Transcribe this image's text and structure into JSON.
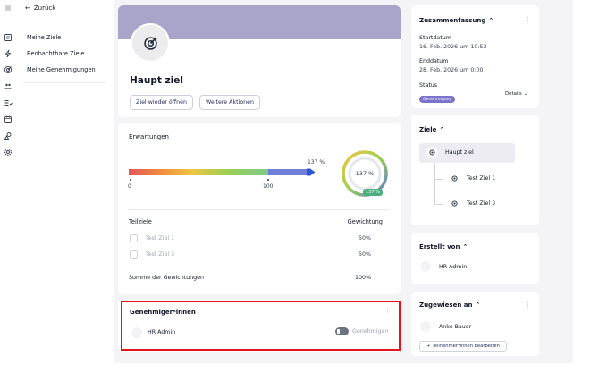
{
  "colors": {
    "accent": "#a9a4c9",
    "status_badge": "#7b72c9",
    "progress_badge": "#4cae7e",
    "highlight_outline": "#e0141e"
  },
  "rail": {
    "icons": [
      "menu-icon",
      "document-icon",
      "lightning-icon",
      "target-icon",
      "people-icon",
      "list-icon",
      "calendar-icon",
      "shapes-icon",
      "gear-icon"
    ]
  },
  "subnav": {
    "back_label": "Zurück",
    "items": [
      "Meine Ziele",
      "Beobachtbare Ziele",
      "Meine Genehmigungen"
    ]
  },
  "goal": {
    "title": "Haupt ziel",
    "reopen_button": "Ziel wieder öffnen",
    "more_actions_button": "Weitere Aktionen"
  },
  "expectations": {
    "title": "Erwartungen",
    "progress_label": "137 %",
    "progress_value": 137,
    "scale_start": "0",
    "scale_end": "100",
    "ring_label": "137 %",
    "ring_badge": "137 %",
    "columns": [
      "Teilziele",
      "Gewichtung"
    ],
    "rows": [
      {
        "name": "Test Ziel 1",
        "weight": "50%"
      },
      {
        "name": "Test Ziel 3",
        "weight": "50%"
      }
    ],
    "sum_label": "Summe der Gewichtungen",
    "sum_value": "100%"
  },
  "approvers": {
    "title": "Genehmiger*innen",
    "name": "HR Admin",
    "status": "Genehmigen"
  },
  "summary": {
    "title": "Zusammenfassung",
    "start_label": "Startdatum",
    "start_value": "16. Feb. 2026 um 10:53",
    "end_label": "Enddatum",
    "end_value": "28. Feb. 2026 um 0:00",
    "status_label": "Status",
    "status_badge": "Genehmigung",
    "details_link": "Details"
  },
  "goals_tree": {
    "title": "Ziele",
    "root": "Haupt ziel",
    "children": [
      "Test Ziel 1",
      "Test Ziel 3"
    ]
  },
  "created_by": {
    "title": "Erstellt von",
    "name": "HR Admin"
  },
  "assigned_to": {
    "title": "Zugewiesen an",
    "name": "Anke Bauer",
    "edit_button": "Teilnehmer*innen bearbeiten"
  }
}
